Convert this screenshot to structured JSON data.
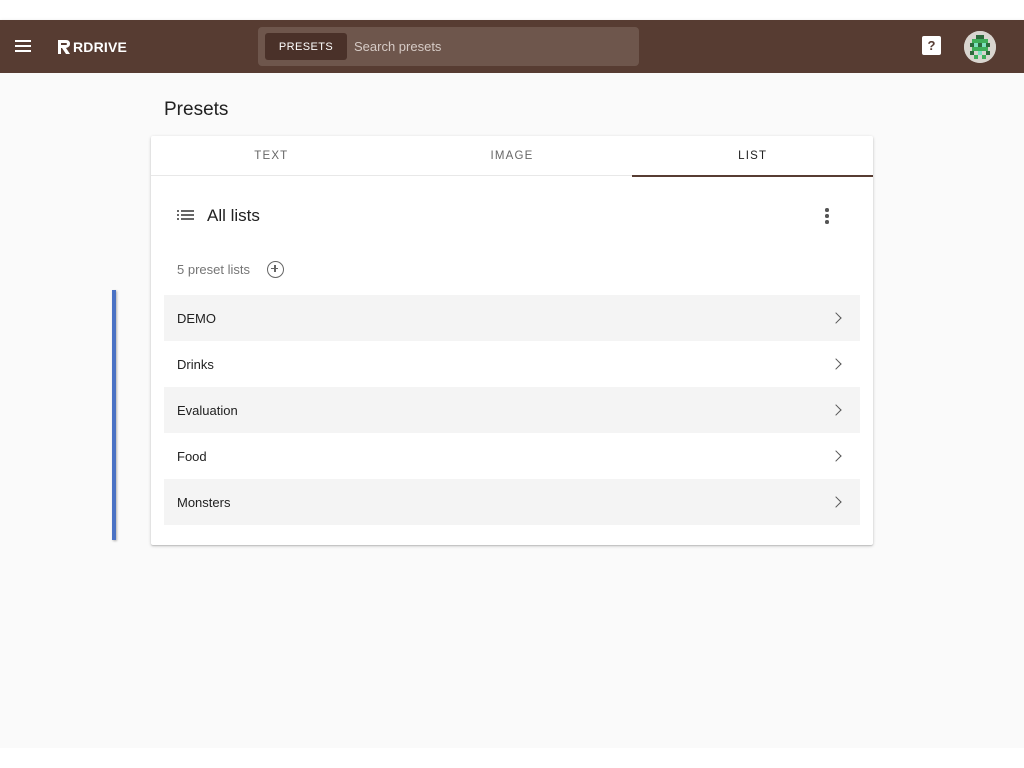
{
  "appbar": {
    "logo_text": "RDRIVE",
    "search_chip_label": "PRESETS",
    "search_placeholder": "Search presets",
    "help_symbol": "?",
    "color": "#573c32"
  },
  "page": {
    "title": "Presets"
  },
  "tabs": [
    {
      "label": "TEXT",
      "active": false
    },
    {
      "label": "IMAGE",
      "active": false
    },
    {
      "label": "LIST",
      "active": true
    }
  ],
  "list_panel": {
    "title": "All lists",
    "count_text": "5 preset lists",
    "items": [
      {
        "label": "DEMO"
      },
      {
        "label": "Drinks"
      },
      {
        "label": "Evaluation"
      },
      {
        "label": "Food"
      },
      {
        "label": "Monsters"
      }
    ]
  },
  "icons": {
    "menu": "hamburger-menu-icon",
    "logo": "rdrive-logo-icon",
    "help": "help-icon",
    "avatar": "pixel-avatar-icon",
    "list": "list-icon",
    "more": "more-vert-icon",
    "add": "add-circle-icon",
    "chevron": "chevron-right-icon"
  }
}
